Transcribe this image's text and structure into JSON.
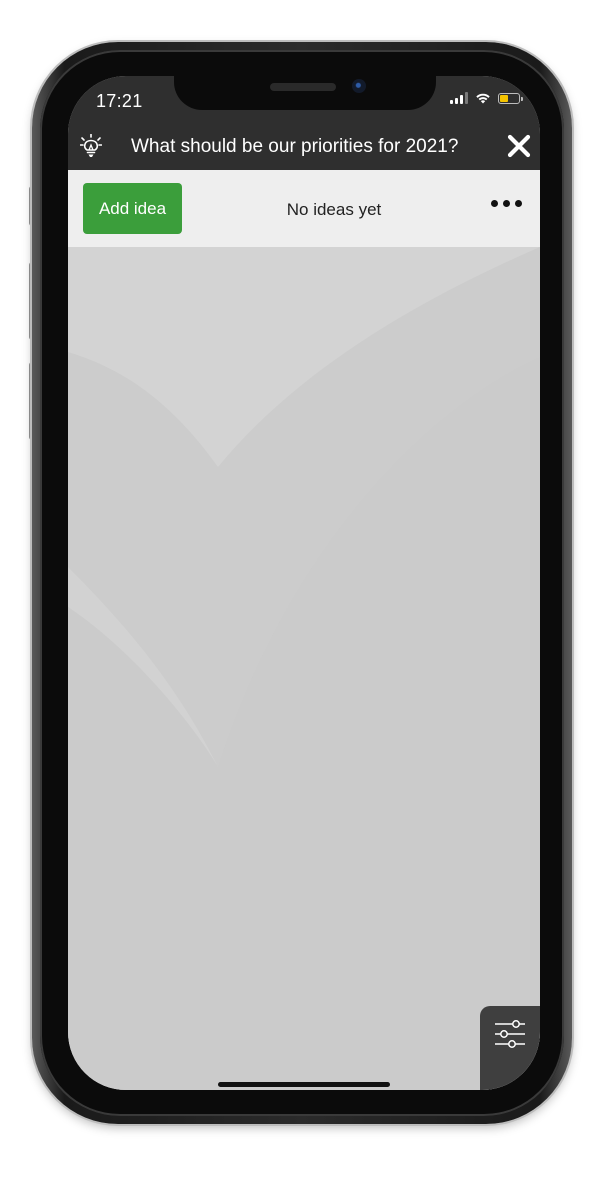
{
  "status_bar": {
    "time": "17:21",
    "battery_color": "#f5c400"
  },
  "header": {
    "title": "What should be our priorities for 2021?",
    "icon": "lightbulb-icon",
    "close_icon": "close-icon",
    "background": "#2f2f2f"
  },
  "toolbar": {
    "add_idea_label": "Add idea",
    "status_text": "No ideas yet",
    "more_icon": "more-options-icon",
    "accent": "#3b9e3b"
  },
  "content": {
    "background": "#cccccc",
    "filter_icon": "filter-sliders-icon"
  }
}
